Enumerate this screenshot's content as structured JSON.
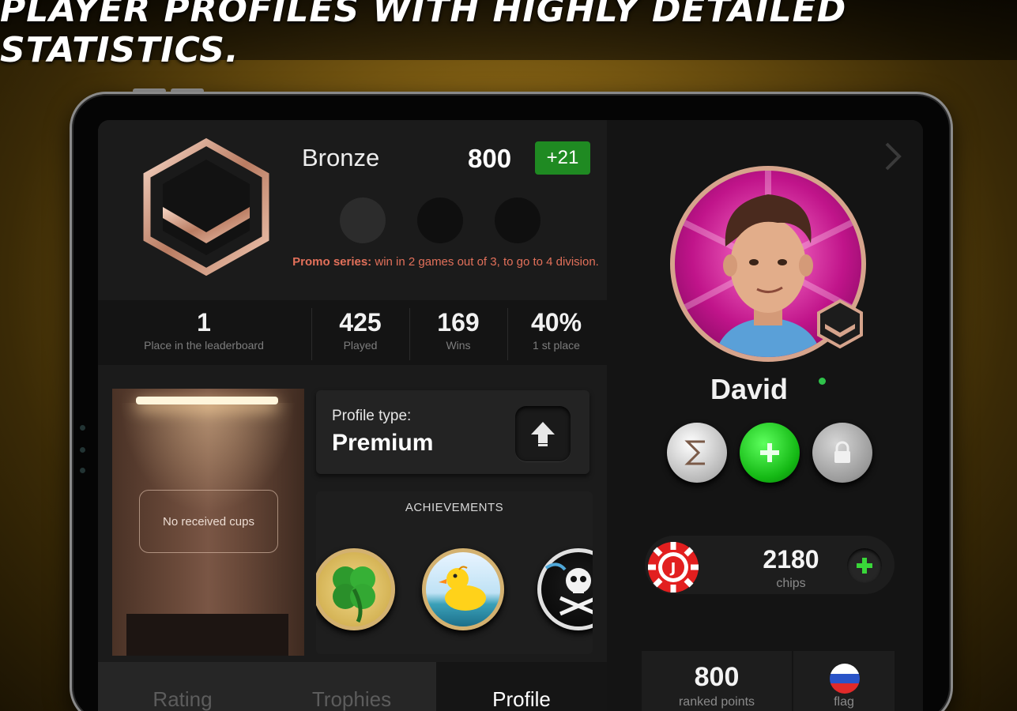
{
  "banner": {
    "title": "PLAYER PROFILES WITH HIGHLY DETAILED STATISTICS."
  },
  "rank": {
    "name": "Bronze",
    "points": "800",
    "delta": "+21",
    "promo_label": "Promo series:",
    "promo_text": " win in 2 games out of 3, to go to 4 division.",
    "promo_games": 3
  },
  "stats": [
    {
      "value": "1",
      "label": "Place in the leaderboard"
    },
    {
      "value": "425",
      "label": "Played"
    },
    {
      "value": "169",
      "label": "Wins"
    },
    {
      "value": "40%",
      "label": "1 st place"
    }
  ],
  "cups": {
    "empty_text": "No received cups"
  },
  "profile_type": {
    "label": "Profile type:",
    "value": "Premium"
  },
  "achievements": {
    "title": "ACHIEVEMENTS",
    "items": [
      {
        "icon": "four-leaf-clover-icon"
      },
      {
        "icon": "rubber-duck-icon"
      },
      {
        "icon": "pirate-flag-icon"
      }
    ]
  },
  "tabs": [
    {
      "label": "Rating",
      "active": false
    },
    {
      "label": "Trophies",
      "active": false
    },
    {
      "label": "Profile",
      "active": true
    }
  ],
  "player": {
    "name": "David",
    "online": true
  },
  "actions": [
    {
      "icon": "sigma-icon"
    },
    {
      "icon": "add-friend-icon"
    },
    {
      "icon": "lock-icon"
    }
  ],
  "chips": {
    "value": "2180",
    "label": "chips"
  },
  "ranked": {
    "value": "800",
    "label": "ranked points"
  },
  "flag": {
    "label": "flag",
    "country_icon": "russia-flag-icon"
  },
  "colors": {
    "accent_green": "#1f8a22",
    "promo_orange": "#e2705a",
    "bronze": "#d6a48c"
  }
}
